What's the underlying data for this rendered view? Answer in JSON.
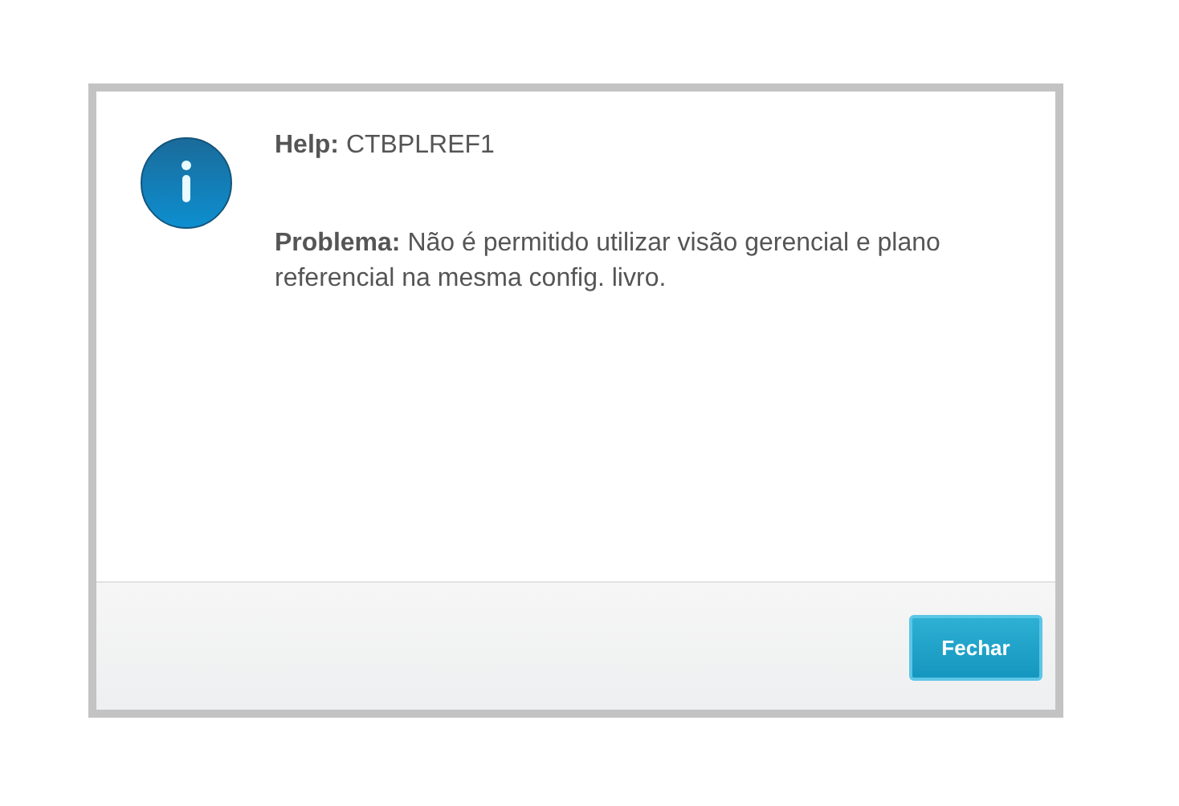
{
  "dialog": {
    "kind": "info",
    "help": "**Help:** CTBPLREF1",
    "message": "**Problema:** Não é permitido utilizar visão gerencial e plano referencial na mesma config. livro.",
    "buttons": [
      "Fechar"
    ]
  }
}
